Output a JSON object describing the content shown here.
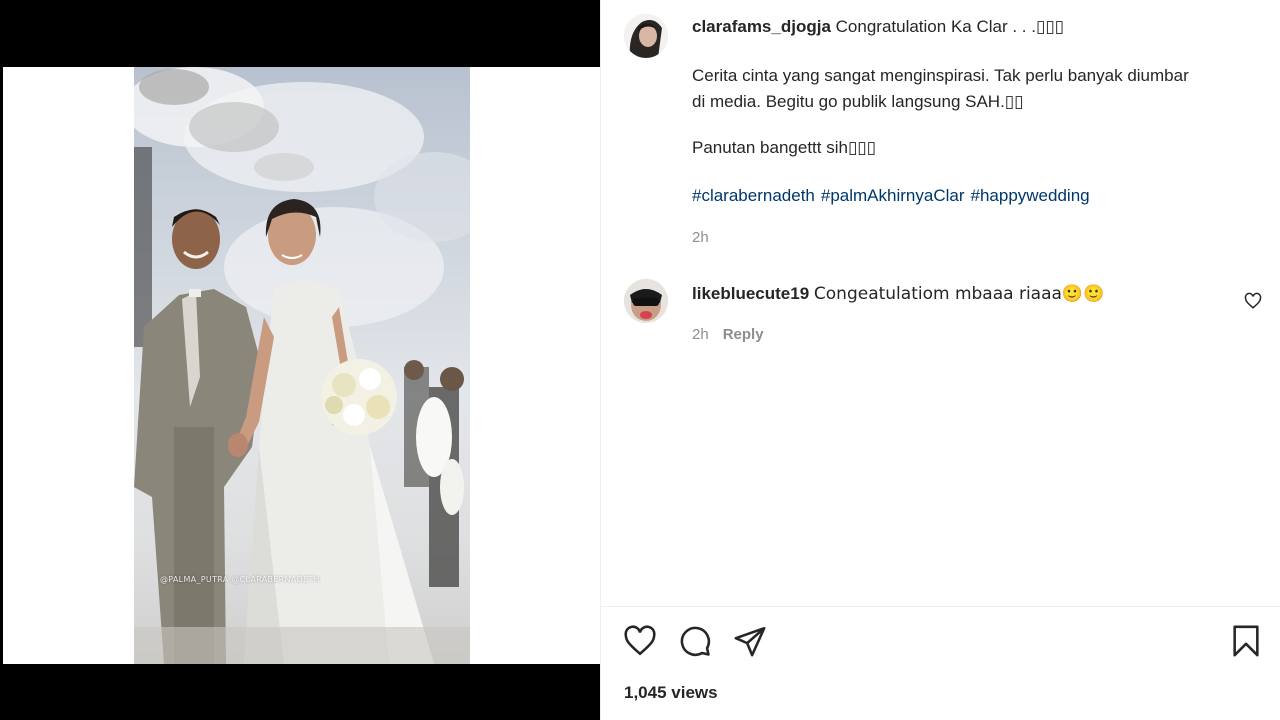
{
  "post": {
    "author": "clarafams_djogja",
    "caption_title": "Congratulation Ka Clar . . .▯▯▯",
    "caption_p1_line1": "Cerita cinta yang sangat menginspirasi. Tak perlu banyak diumbar",
    "caption_p1_line2": "di media. Begitu go publik langsung SAH.▯▯",
    "caption_p2": "Panutan bangettt sih▯▯▯",
    "hashtags": [
      "#clarabernadeth",
      "#palmAkhirnyaClar",
      "#happywedding"
    ],
    "caption_time": "2h",
    "views": "1,045 views"
  },
  "comment": {
    "author": "likebluecute19",
    "text": "Congeatulatiom mbaaa riaaa🙂🙂",
    "time": "2h",
    "reply_label": "Reply"
  },
  "video": {
    "watermark": "@PALMA_PUTRA @CLARABERNADETH"
  },
  "icons": {
    "like": "heart-icon",
    "comment": "comment-bubble-icon",
    "share": "paper-plane-icon",
    "save": "bookmark-icon",
    "comment_like": "heart-icon"
  },
  "colors": {
    "text": "#262626",
    "muted": "#8e8e8e",
    "hashtag": "#00376b",
    "media_background": "#000000"
  }
}
